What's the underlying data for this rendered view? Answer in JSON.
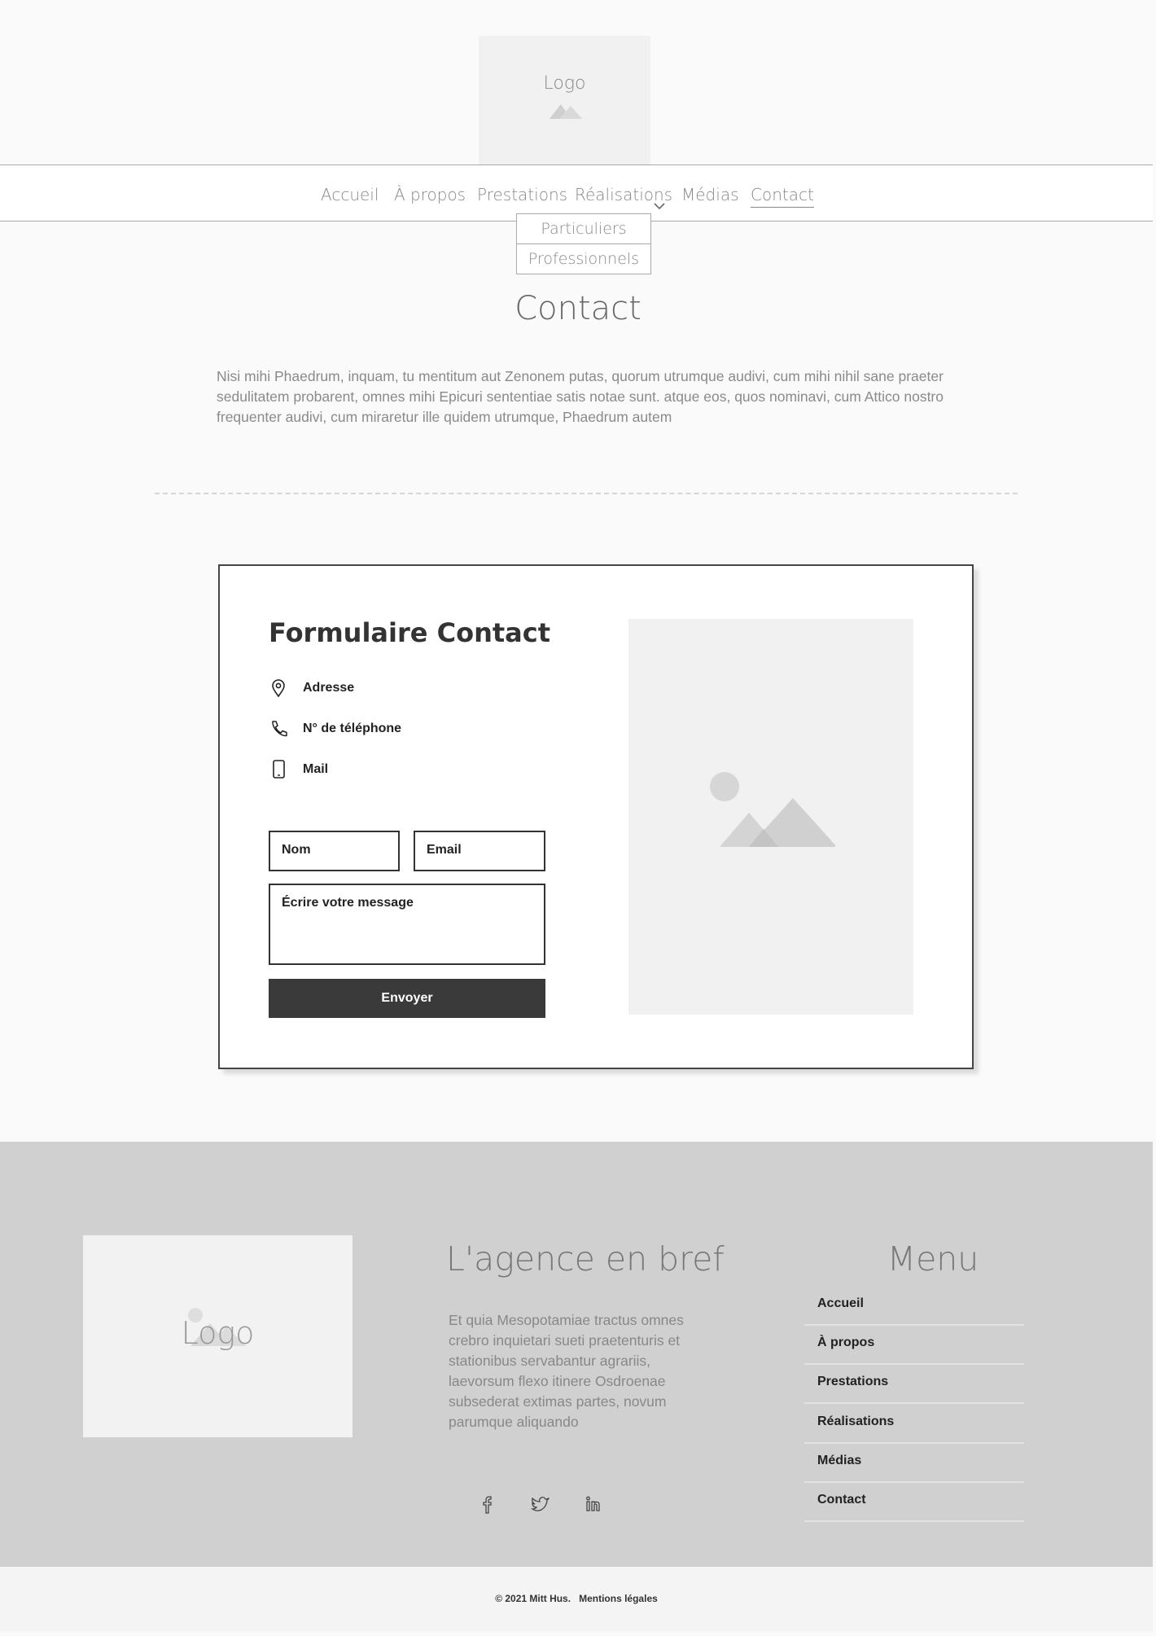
{
  "header": {
    "logo_text": "Logo"
  },
  "nav": {
    "items": [
      "Accueil",
      "À propos",
      "Prestations",
      "Réalisations",
      "Médias",
      "Contact"
    ],
    "active": "Contact",
    "dropdown": [
      "Particuliers",
      "Professionnels"
    ]
  },
  "page": {
    "title": "Contact",
    "intro": "Nisi mihi Phaedrum, inquam, tu mentitum aut Zenonem putas, quorum utrumque audivi, cum mihi nihil sane praeter sedulitatem probarent, omnes mihi Epicuri sententiae satis notae sunt. atque eos, quos nominavi, cum Attico nostro frequenter audivi, cum miraretur ille quidem utrumque, Phaedrum autem"
  },
  "contact_form": {
    "title": "Formulaire Contact",
    "info": [
      {
        "icon": "location-pin-icon",
        "label": "Adresse"
      },
      {
        "icon": "phone-icon",
        "label": "N° de téléphone"
      },
      {
        "icon": "mobile-icon",
        "label": "Mail"
      }
    ],
    "name_placeholder": "Nom",
    "email_placeholder": "Email",
    "message_placeholder": "Écrire votre message",
    "submit_label": "Envoyer"
  },
  "footer": {
    "logo_text": "Logo",
    "about_title": "L'agence en bref",
    "about_text": "Et quia Mesopotamiae tractus omnes crebro inquietari sueti praetenturis et stationibus servabantur agrariis, laevorsum flexo itinere Osdroenae subsederat extimas partes, novum parumque aliquando",
    "social": [
      {
        "icon": "facebook-icon",
        "glyph": "f"
      },
      {
        "icon": "twitter-icon",
        "glyph": "t"
      },
      {
        "icon": "linkedin-icon",
        "glyph": "in"
      }
    ],
    "menu_title": "Menu",
    "menu_items": [
      "Accueil",
      "À propos",
      "Prestations",
      "Réalisations",
      "Médias",
      "Contact"
    ],
    "copyright": "© 2021 Mitt Hus.",
    "legal_link": "Mentions légales"
  },
  "colors": {
    "background": "#fafafa",
    "footer_bg": "#d0d0d0",
    "button_bg": "#3a3a3a",
    "placeholder_bg": "#f1f1f1"
  }
}
